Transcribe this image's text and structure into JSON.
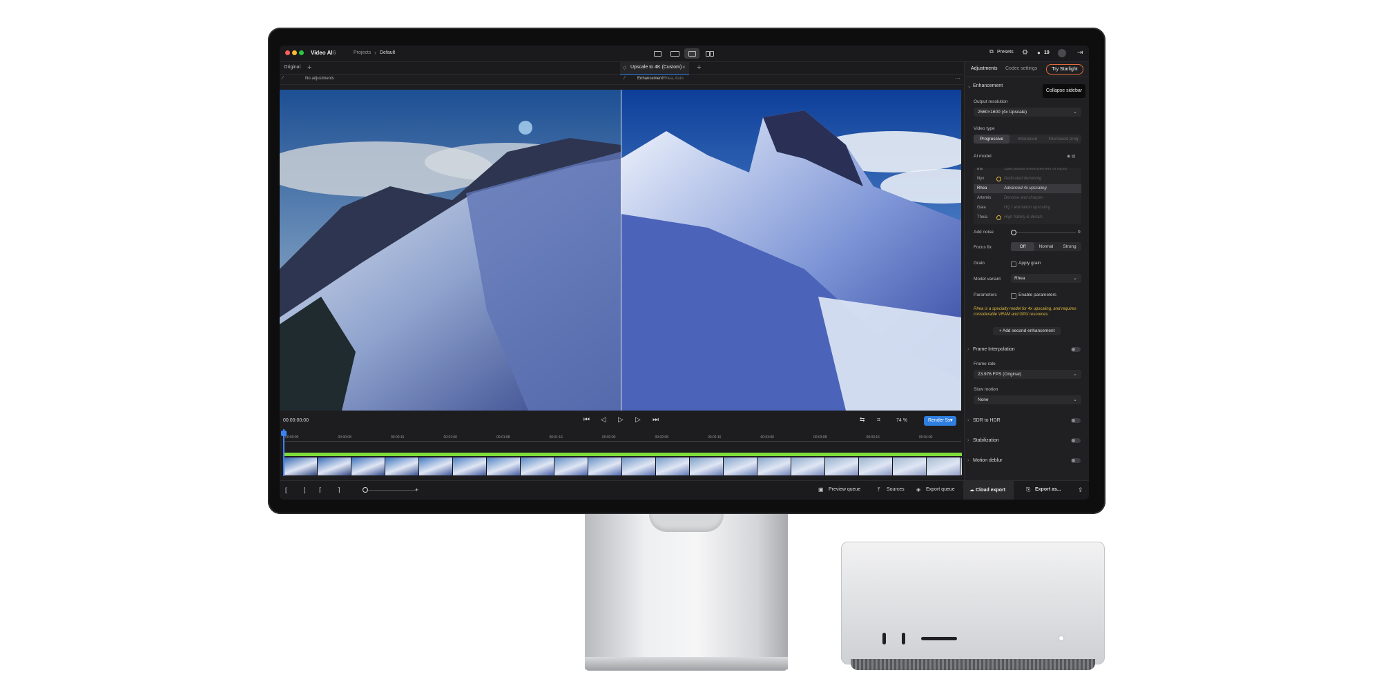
{
  "app": {
    "name": "Video AI",
    "version": "6",
    "breadcrumb": [
      "Projects",
      "Default"
    ]
  },
  "toolbar": {
    "presets_label": "Presets",
    "credits": "19"
  },
  "tabs": {
    "original_label": "Original",
    "active_label": "Upscale to 4K (Custom)"
  },
  "info": {
    "left_text": "No adjustments",
    "right_title": "Enhancement",
    "right_sub": "Rhea, Auto"
  },
  "transport": {
    "timecode": "00:00:00;00",
    "zoom": "74 %",
    "render_label": "Render 5s"
  },
  "timeline": {
    "ticks": [
      "00:00:00",
      "00:00:08",
      "00:00:16",
      "00:01:00",
      "00:01:08",
      "00:01:16",
      "00:02:00",
      "00:02:08",
      "00:02:16",
      "00:03:00",
      "00:03:08",
      "00:03:16",
      "00:04:00"
    ]
  },
  "bottombar": {
    "preview_queue": "Preview queue",
    "sources": "Sources",
    "export_queue": "Export queue",
    "cloud_export": "Cloud export",
    "export_as": "Export as..."
  },
  "sidebar": {
    "tabs": [
      "Adjustments",
      "Codec settings"
    ],
    "starlight_label": "Try Starlight",
    "tooltip": "Collapse sidebar",
    "enhancement": {
      "title": "Enhancement",
      "output_resolution_label": "Output resolution",
      "output_resolution_value": "2560×1600 (4x Upscale)",
      "video_type_label": "Video type",
      "video_types": [
        "Progressive",
        "Interlaced",
        "Interlaced prog"
      ],
      "ai_model_label": "AI model",
      "models": [
        {
          "name": "Iris",
          "desc": "Specialized enhancement of faces"
        },
        {
          "name": "Nyx",
          "desc": "Dedicated denoising"
        },
        {
          "name": "Rhea",
          "desc": "Advanced 4x upscaling"
        },
        {
          "name": "Artemis",
          "desc": "Denoise and sharpen"
        },
        {
          "name": "Gaia",
          "desc": "HQ / animation upscaling"
        },
        {
          "name": "Theia",
          "desc": "High fidelity & details"
        }
      ],
      "add_noise_label": "Add noise",
      "add_noise_value": "0",
      "focus_fix_label": "Focus fix",
      "focus_fix_options": [
        "Off",
        "Normal",
        "Strong"
      ],
      "grain_label": "Grain",
      "grain_option": "Apply grain",
      "model_variant_label": "Model variant",
      "model_variant_value": "Rhea",
      "parameters_label": "Parameters",
      "parameters_option": "Enable parameters",
      "note": "Rhea is a specialty model for 4x upscaling, and requires considerable VRAM and GPU resources.",
      "add_second": "Add second enhancement"
    },
    "frame_interpolation": "Frame Interpolation",
    "frame_rate_label": "Frame rate",
    "frame_rate_value": "23.976 FPS (Original)",
    "slow_motion_label": "Slow motion",
    "slow_motion_value": "None",
    "sdr_to_hdr": "SDR to HDR",
    "stabilization": "Stabilization",
    "motion_deblur": "Motion deblur"
  },
  "colors": {
    "accent": "#3b82f6",
    "render": "#2f7fe0",
    "timeline_green": "#7fdc3a",
    "note": "#e0b93b",
    "starlight_border": "#e06b3a"
  }
}
